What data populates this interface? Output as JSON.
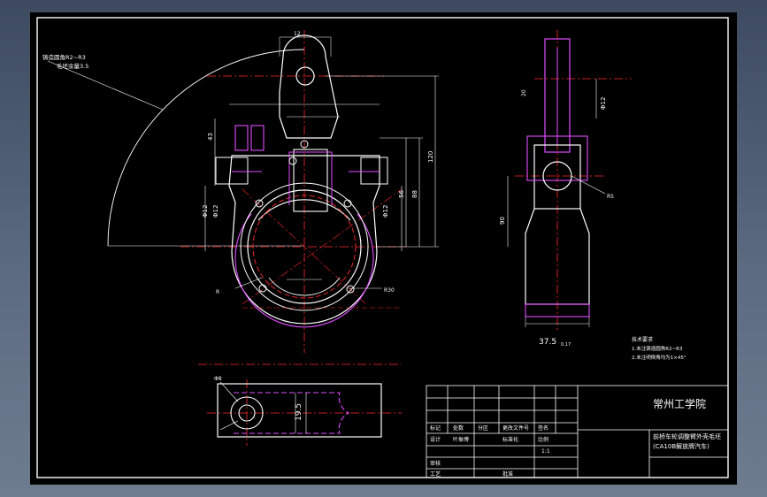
{
  "title_block": {
    "school": "常州工学院",
    "part_name": "前桥车轮调整臂外壳毛坯",
    "vehicle": "(CA10B解放牌汽车)",
    "col_mark": "标记",
    "col_count": "处数",
    "col_zone": "分区",
    "col_change_doc": "更改文件号",
    "col_sign": "签名",
    "row_design": "设计",
    "designer": "叶振博",
    "std": "标准化",
    "ratio_label": "比例",
    "ratio": "1:1",
    "row_review": "审核",
    "row_process": "工艺",
    "row_approve": "批准"
  },
  "notes": {
    "heading": "技术要求",
    "item1": "1.未注铸造圆角R2~R3",
    "item2": "2.未注明倒角均为1×45°"
  },
  "callout_left": {
    "line1": "铸造圆角R2~R3",
    "line2": "毛坯余量3.5"
  },
  "dimensions": {
    "width_bottom": "37.5",
    "width_bottom_tol": "0.17",
    "dia_top": "Φ12",
    "dia_left1": "Φ12",
    "dia_left2": "Φ12",
    "dia_right": "Φ12",
    "bottom_dim": "19.5",
    "dia_small": "Φ8",
    "radius_r30": "R30",
    "side_r": "R5",
    "r_main": "R",
    "dim_43": "43",
    "dim_120": "120",
    "dim_56": "56",
    "dim_88": "88",
    "dim_90": "90",
    "top_dim": "12",
    "side_dim": "20"
  }
}
